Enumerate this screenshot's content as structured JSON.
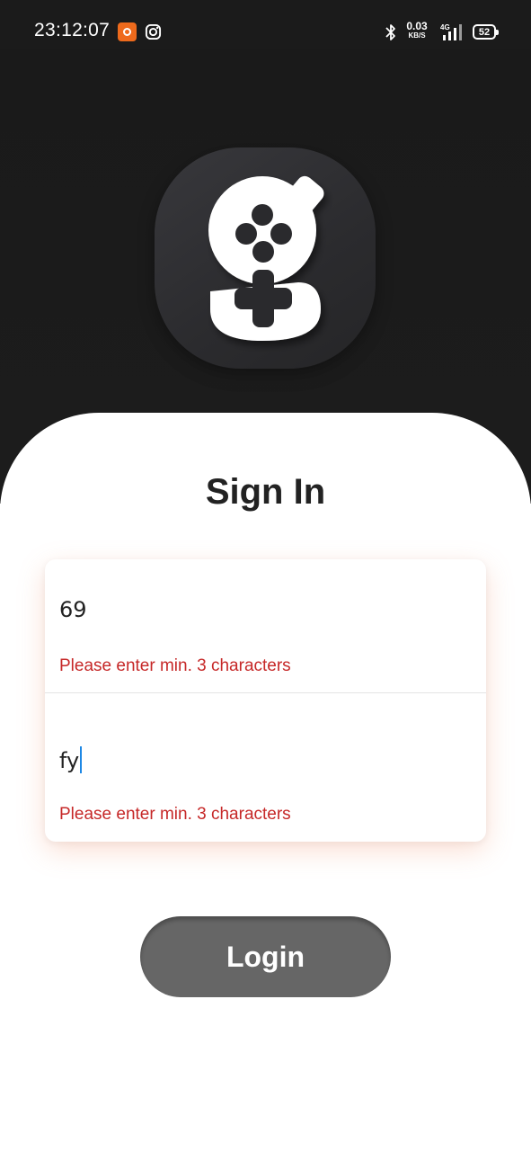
{
  "status_bar": {
    "time": "23:12:07",
    "net_speed_value": "0.03",
    "net_speed_unit": "KB/S",
    "network_type": "4G",
    "battery_level": "52",
    "icons": [
      "app-notification-icon",
      "instagram-icon",
      "bluetooth-icon",
      "signal-icon",
      "battery-icon"
    ]
  },
  "logo": {
    "icon": "game-controller-logo-icon"
  },
  "title": "Sign In",
  "form": {
    "username": {
      "value": "69",
      "error": "Please enter min. 3 characters"
    },
    "password": {
      "value": "fy",
      "error": "Please enter min. 3 characters"
    }
  },
  "login_label": "Login",
  "colors": {
    "background_dark": "#1b1b1b",
    "sheet": "#ffffff",
    "error": "#c62828",
    "button": "#666666",
    "caret": "#1e88e5"
  }
}
